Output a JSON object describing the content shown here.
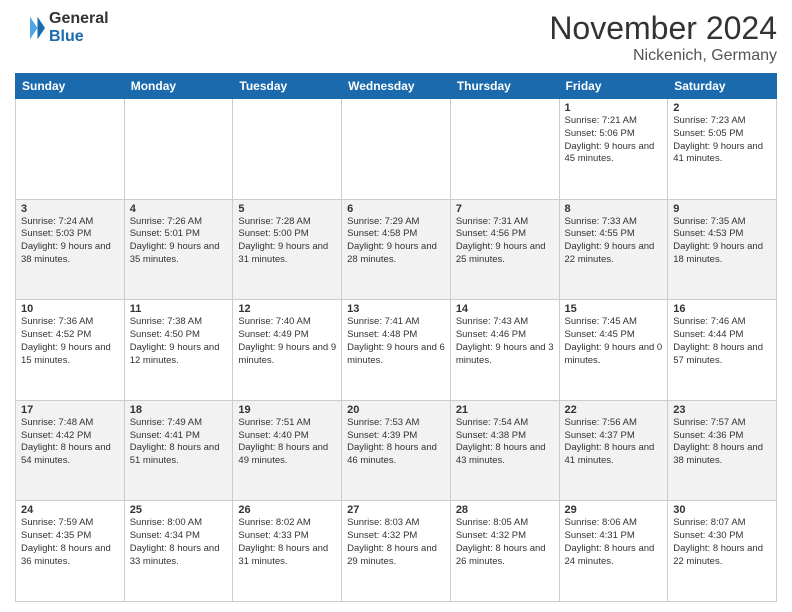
{
  "header": {
    "logo_general": "General",
    "logo_blue": "Blue",
    "month_title": "November 2024",
    "location": "Nickenich, Germany"
  },
  "weekdays": [
    "Sunday",
    "Monday",
    "Tuesday",
    "Wednesday",
    "Thursday",
    "Friday",
    "Saturday"
  ],
  "weeks": [
    [
      {
        "day": "",
        "info": ""
      },
      {
        "day": "",
        "info": ""
      },
      {
        "day": "",
        "info": ""
      },
      {
        "day": "",
        "info": ""
      },
      {
        "day": "",
        "info": ""
      },
      {
        "day": "1",
        "info": "Sunrise: 7:21 AM\nSunset: 5:06 PM\nDaylight: 9 hours and 45 minutes."
      },
      {
        "day": "2",
        "info": "Sunrise: 7:23 AM\nSunset: 5:05 PM\nDaylight: 9 hours and 41 minutes."
      }
    ],
    [
      {
        "day": "3",
        "info": "Sunrise: 7:24 AM\nSunset: 5:03 PM\nDaylight: 9 hours and 38 minutes."
      },
      {
        "day": "4",
        "info": "Sunrise: 7:26 AM\nSunset: 5:01 PM\nDaylight: 9 hours and 35 minutes."
      },
      {
        "day": "5",
        "info": "Sunrise: 7:28 AM\nSunset: 5:00 PM\nDaylight: 9 hours and 31 minutes."
      },
      {
        "day": "6",
        "info": "Sunrise: 7:29 AM\nSunset: 4:58 PM\nDaylight: 9 hours and 28 minutes."
      },
      {
        "day": "7",
        "info": "Sunrise: 7:31 AM\nSunset: 4:56 PM\nDaylight: 9 hours and 25 minutes."
      },
      {
        "day": "8",
        "info": "Sunrise: 7:33 AM\nSunset: 4:55 PM\nDaylight: 9 hours and 22 minutes."
      },
      {
        "day": "9",
        "info": "Sunrise: 7:35 AM\nSunset: 4:53 PM\nDaylight: 9 hours and 18 minutes."
      }
    ],
    [
      {
        "day": "10",
        "info": "Sunrise: 7:36 AM\nSunset: 4:52 PM\nDaylight: 9 hours and 15 minutes."
      },
      {
        "day": "11",
        "info": "Sunrise: 7:38 AM\nSunset: 4:50 PM\nDaylight: 9 hours and 12 minutes."
      },
      {
        "day": "12",
        "info": "Sunrise: 7:40 AM\nSunset: 4:49 PM\nDaylight: 9 hours and 9 minutes."
      },
      {
        "day": "13",
        "info": "Sunrise: 7:41 AM\nSunset: 4:48 PM\nDaylight: 9 hours and 6 minutes."
      },
      {
        "day": "14",
        "info": "Sunrise: 7:43 AM\nSunset: 4:46 PM\nDaylight: 9 hours and 3 minutes."
      },
      {
        "day": "15",
        "info": "Sunrise: 7:45 AM\nSunset: 4:45 PM\nDaylight: 9 hours and 0 minutes."
      },
      {
        "day": "16",
        "info": "Sunrise: 7:46 AM\nSunset: 4:44 PM\nDaylight: 8 hours and 57 minutes."
      }
    ],
    [
      {
        "day": "17",
        "info": "Sunrise: 7:48 AM\nSunset: 4:42 PM\nDaylight: 8 hours and 54 minutes."
      },
      {
        "day": "18",
        "info": "Sunrise: 7:49 AM\nSunset: 4:41 PM\nDaylight: 8 hours and 51 minutes."
      },
      {
        "day": "19",
        "info": "Sunrise: 7:51 AM\nSunset: 4:40 PM\nDaylight: 8 hours and 49 minutes."
      },
      {
        "day": "20",
        "info": "Sunrise: 7:53 AM\nSunset: 4:39 PM\nDaylight: 8 hours and 46 minutes."
      },
      {
        "day": "21",
        "info": "Sunrise: 7:54 AM\nSunset: 4:38 PM\nDaylight: 8 hours and 43 minutes."
      },
      {
        "day": "22",
        "info": "Sunrise: 7:56 AM\nSunset: 4:37 PM\nDaylight: 8 hours and 41 minutes."
      },
      {
        "day": "23",
        "info": "Sunrise: 7:57 AM\nSunset: 4:36 PM\nDaylight: 8 hours and 38 minutes."
      }
    ],
    [
      {
        "day": "24",
        "info": "Sunrise: 7:59 AM\nSunset: 4:35 PM\nDaylight: 8 hours and 36 minutes."
      },
      {
        "day": "25",
        "info": "Sunrise: 8:00 AM\nSunset: 4:34 PM\nDaylight: 8 hours and 33 minutes."
      },
      {
        "day": "26",
        "info": "Sunrise: 8:02 AM\nSunset: 4:33 PM\nDaylight: 8 hours and 31 minutes."
      },
      {
        "day": "27",
        "info": "Sunrise: 8:03 AM\nSunset: 4:32 PM\nDaylight: 8 hours and 29 minutes."
      },
      {
        "day": "28",
        "info": "Sunrise: 8:05 AM\nSunset: 4:32 PM\nDaylight: 8 hours and 26 minutes."
      },
      {
        "day": "29",
        "info": "Sunrise: 8:06 AM\nSunset: 4:31 PM\nDaylight: 8 hours and 24 minutes."
      },
      {
        "day": "30",
        "info": "Sunrise: 8:07 AM\nSunset: 4:30 PM\nDaylight: 8 hours and 22 minutes."
      }
    ]
  ]
}
